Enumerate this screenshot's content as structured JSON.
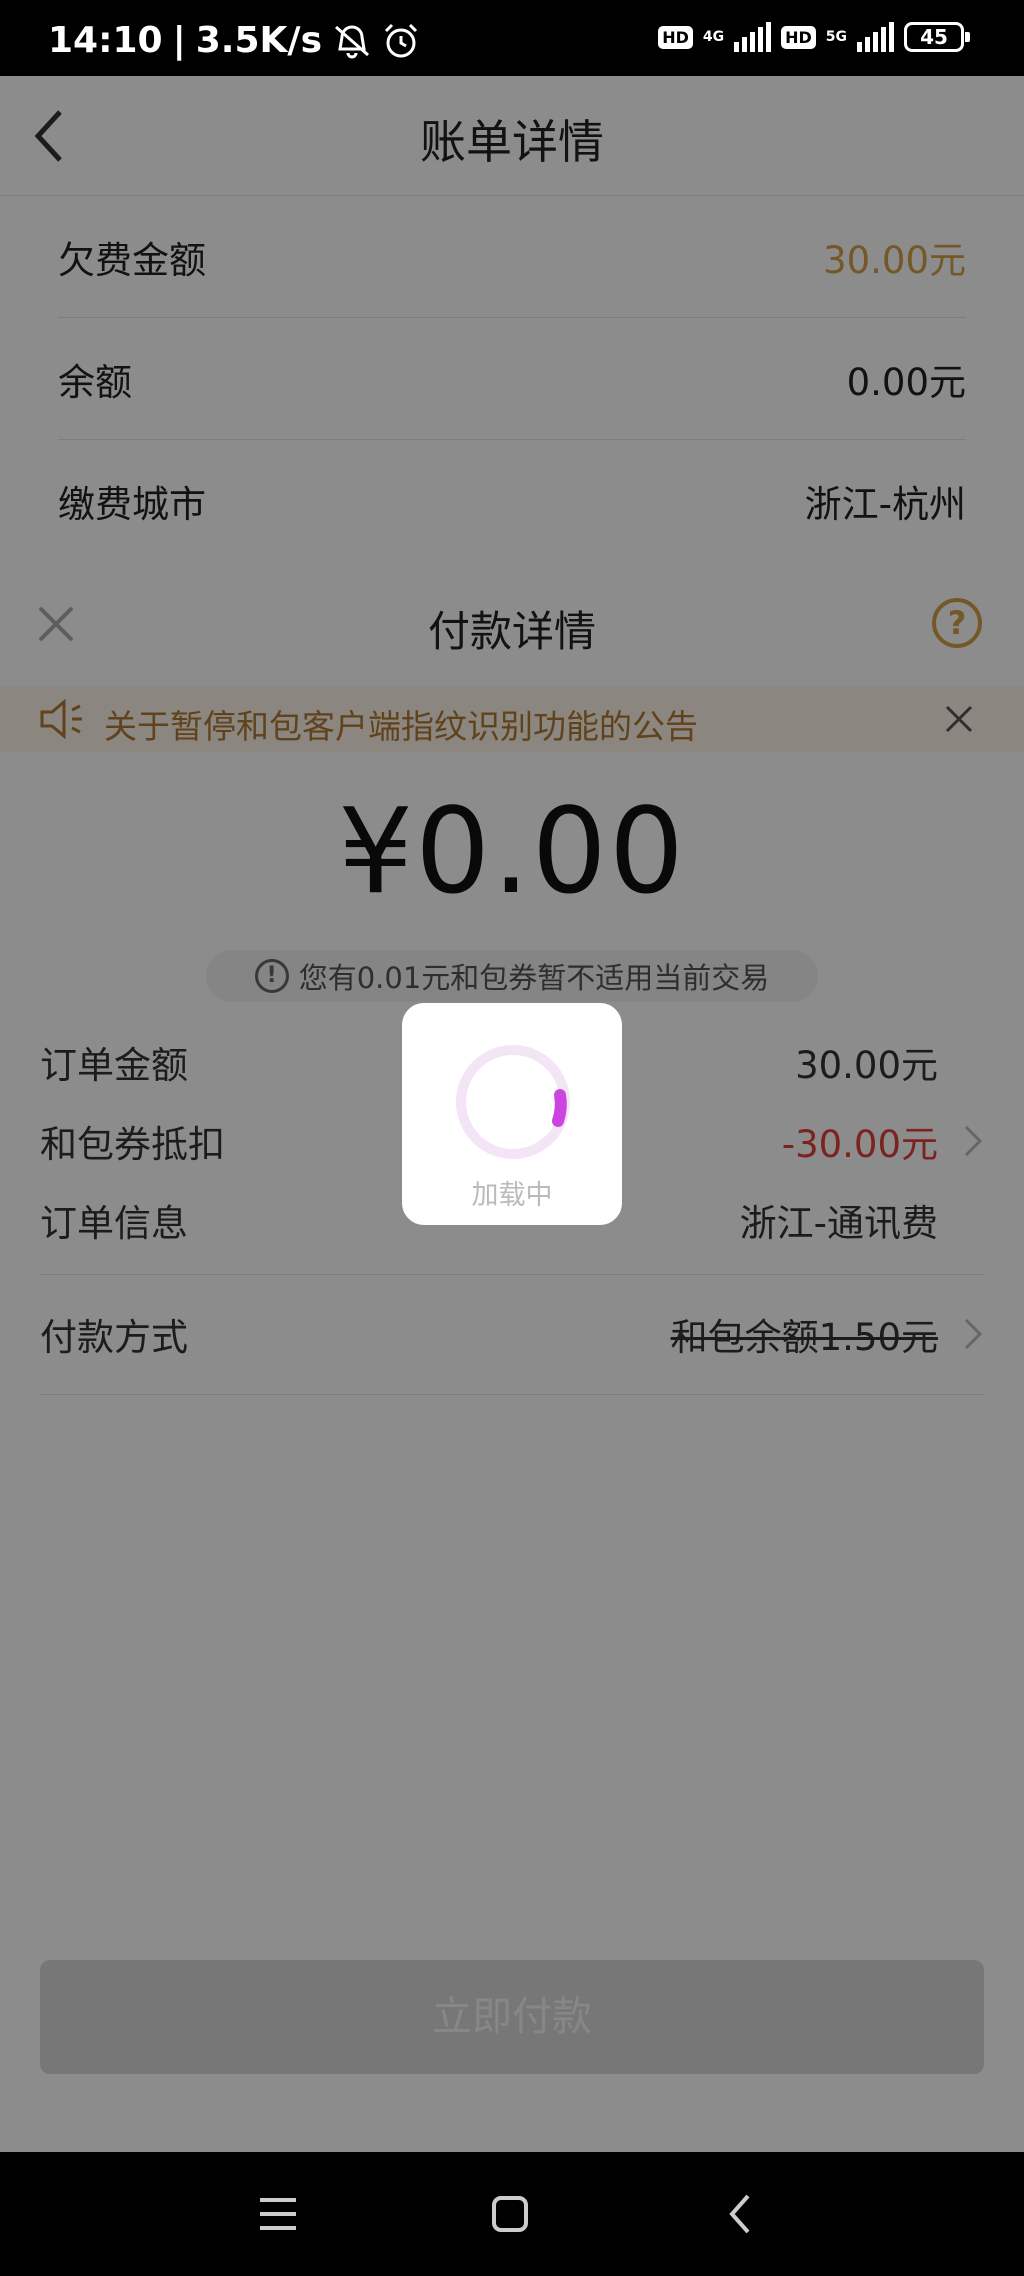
{
  "status_bar": {
    "time": "14:10",
    "separator": "|",
    "speed": "3.5K/s",
    "hd1": "HD",
    "net1": "4G",
    "hd2": "HD",
    "net2": "5G",
    "battery": "45",
    "icons": [
      "mute-icon",
      "alarm-icon"
    ]
  },
  "page": {
    "title": "账单详情",
    "rows": [
      {
        "label": "欠费金额",
        "value": "30.00元"
      },
      {
        "label": "余额",
        "value": "0.00元"
      },
      {
        "label": "缴费城市",
        "value": "浙江-杭州"
      }
    ]
  },
  "sheet": {
    "title": "付款详情",
    "help": "?",
    "notice": "关于暂停和包客户端指纹识别功能的公告",
    "amount": "¥0.00",
    "tip": "您有0.01元和包券暂不适用当前交易",
    "order_rows": [
      {
        "label": "订单金额",
        "value": "30.00元"
      },
      {
        "label": "和包券抵扣",
        "value": "-30.00元"
      },
      {
        "label": "订单信息",
        "value": "浙江-通讯费"
      }
    ],
    "pay_method": {
      "label": "付款方式",
      "value": "和包余额1.50元"
    },
    "pay_button": "立即付款"
  },
  "loading": {
    "text": "加载中"
  },
  "colors": {
    "accent": "#d4a04a",
    "red": "#e0403a",
    "spinner": "#cc44e0"
  }
}
